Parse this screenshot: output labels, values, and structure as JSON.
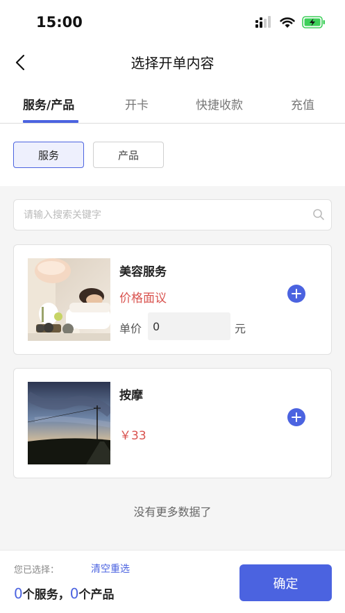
{
  "status_bar": {
    "time": "15:00"
  },
  "nav": {
    "title": "选择开单内容"
  },
  "tabs": [
    {
      "label": "服务/产品",
      "active": true
    },
    {
      "label": "开卡",
      "active": false
    },
    {
      "label": "快捷收款",
      "active": false
    },
    {
      "label": "充值",
      "active": false
    }
  ],
  "type_filter": {
    "service_label": "服务",
    "product_label": "产品",
    "selected": "服务"
  },
  "search": {
    "placeholder": "请输入搜索关键字",
    "value": ""
  },
  "items": [
    {
      "name": "美容服务",
      "price": "价格面议",
      "unit_label": "单价",
      "unit_value": "0",
      "unit_suffix": "元"
    },
    {
      "name": "按摩",
      "price": "￥33"
    }
  ],
  "list_end_text": "没有更多数据了",
  "footer": {
    "selected_label": "您已选择：",
    "clear_label": "清空重选",
    "service_count": "0",
    "service_text": "个服务，",
    "product_count": "0",
    "product_text": "个产品",
    "confirm_label": "确定"
  },
  "colors": {
    "accent": "#4b63e0",
    "price_red": "#d9534f",
    "battery_green": "#3ecf5a"
  },
  "icons": [
    "back-arrow-icon",
    "search-icon",
    "plus-icon",
    "signal-icon",
    "wifi-icon",
    "battery-charging-icon"
  ]
}
